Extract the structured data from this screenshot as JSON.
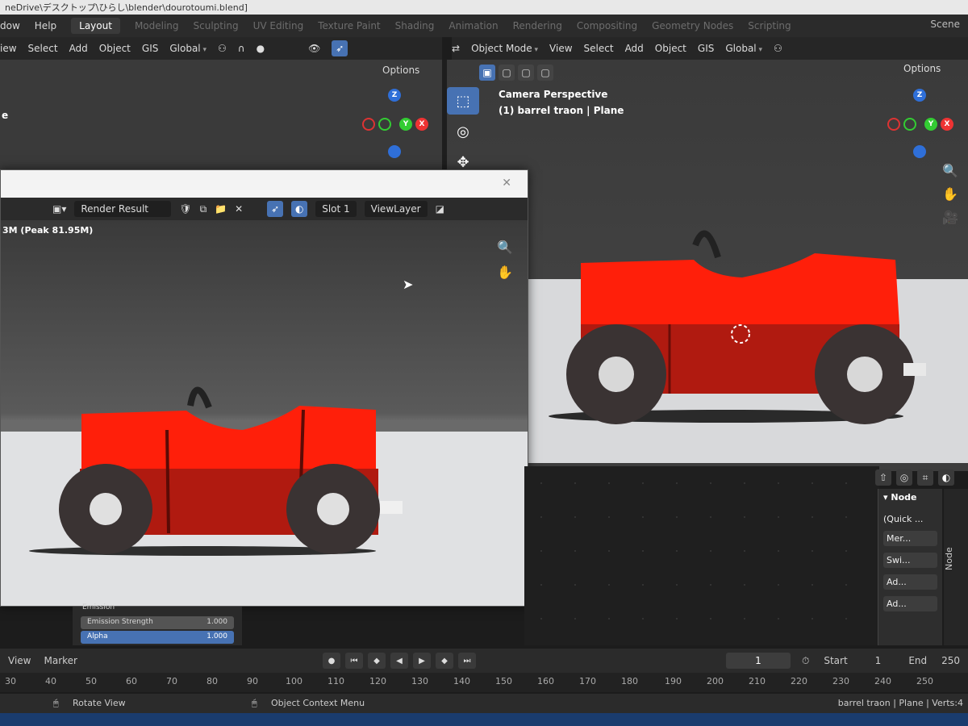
{
  "window_title": "neDrive\\デスクトップ\\ひらし\\blender\\dourotoumi.blend]",
  "topbar": {
    "menus": [
      "dow",
      "Help"
    ],
    "workspaces": [
      "Layout",
      "Modeling",
      "Sculpting",
      "UV Editing",
      "Texture Paint",
      "Shading",
      "Animation",
      "Rendering",
      "Compositing",
      "Geometry Nodes",
      "Scripting"
    ],
    "active_workspace": "Layout",
    "scene": "Scene"
  },
  "left_header": {
    "items": [
      "iew",
      "Select",
      "Add",
      "Object",
      "GIS"
    ],
    "transform": "Global",
    "options": "Options"
  },
  "right_header": {
    "mode": "Object Mode",
    "items": [
      "View",
      "Select",
      "Add",
      "Object",
      "GIS"
    ],
    "transform": "Global",
    "options": "Options"
  },
  "viewport": {
    "camera_label": "Camera Perspective",
    "object_label": "(1) barrel traon | Plane",
    "left_label": "e"
  },
  "render_window": {
    "title": "Render Result",
    "slot": "Slot 1",
    "view_layer": "ViewLayer",
    "memory": "3M (Peak 81.95M)"
  },
  "node_panel": {
    "title": "Node",
    "items": [
      "(Quick ...",
      "Mer...",
      "Swi...",
      "Ad...",
      "Ad..."
    ],
    "tab": "Node"
  },
  "material": {
    "header": "Emission",
    "rows": [
      {
        "label": "Emission Strength",
        "value": "1.000"
      },
      {
        "label": "Alpha",
        "value": "1.000"
      }
    ]
  },
  "timeline": {
    "menus": [
      "View",
      "Marker"
    ],
    "current_frame": "1",
    "start_label": "Start",
    "start": "1",
    "end_label": "End",
    "end": "250",
    "ticks": [
      "30",
      "40",
      "50",
      "60",
      "70",
      "80",
      "90",
      "100",
      "110",
      "120",
      "130",
      "140",
      "150",
      "160",
      "170",
      "180",
      "190",
      "200",
      "210",
      "220",
      "230",
      "240",
      "250"
    ]
  },
  "statusbar": {
    "left": "Rotate View",
    "middle": "Object Context Menu",
    "right": "barrel traon | Plane | Verts:4"
  },
  "colors": {
    "car_red": "#ff1f0a",
    "car_dark": "#b01a10",
    "tire": "#3a3333",
    "accent": "#4772b3"
  }
}
